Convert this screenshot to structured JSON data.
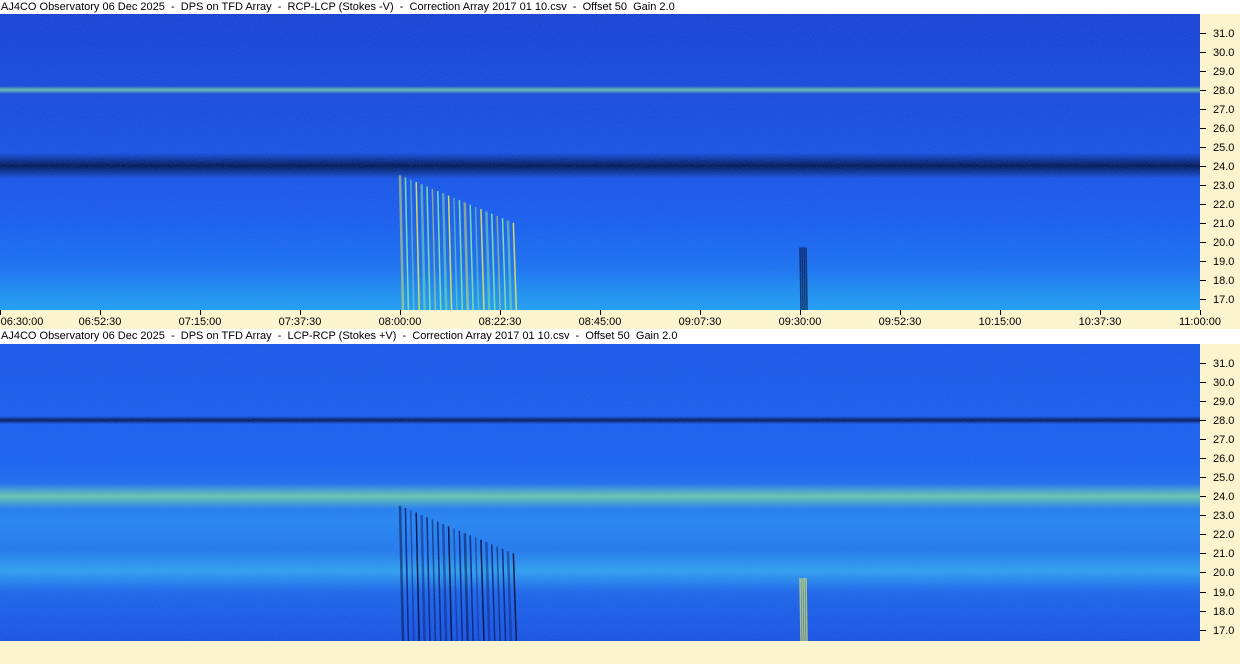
{
  "chart_data": [
    {
      "type": "heatmap",
      "title": "AJ4CO Observatory 06 Dec 2025  -  DPS on TFD Array  -  RCP-LCP (Stokes -V)  -  Correction Array 2017 01 10.csv  -  Offset 50  Gain 2.0",
      "x_tick_labels": [
        "06:30:00",
        "06:52:30",
        "07:15:00",
        "07:37:30",
        "08:00:00",
        "08:22:30",
        "08:45:00",
        "09:07:30",
        "09:30:00",
        "09:52:30",
        "10:15:00",
        "10:37:30",
        "11:00:00"
      ],
      "x_range": [
        "06:30:00",
        "11:00:00"
      ],
      "y_tick_labels": [
        "31.0",
        "30.0",
        "29.0",
        "28.0",
        "27.0",
        "26.0",
        "25.0",
        "24.0",
        "23.0",
        "22.0",
        "21.0",
        "20.0",
        "19.0",
        "18.0",
        "17.0"
      ],
      "y_range_mhz": [
        16.4,
        32.0
      ],
      "colors": {
        "low": "#00032a",
        "mid": "#1a5cf0",
        "high": "#8ff090",
        "peak": "#f5f040"
      },
      "features": [
        {
          "kind": "band",
          "freq_mhz": 24.0,
          "polarity": "dark"
        },
        {
          "kind": "band",
          "freq_mhz": 28.0,
          "polarity": "bright"
        },
        {
          "kind": "burst_train",
          "start": "08:00:00",
          "end": "08:25:30",
          "freq_top_mhz": 23.5,
          "freq_bottom_mhz": 16.4,
          "polarity": "bright"
        },
        {
          "kind": "spike",
          "time": "09:30:00",
          "freq_mhz": 18.5,
          "polarity": "dark"
        }
      ]
    },
    {
      "type": "heatmap",
      "title": "AJ4CO Observatory 06 Dec 2025  -  DPS on TFD Array  -  LCP-RCP (Stokes +V)  -  Correction Array 2017 01 10.csv  -  Offset 50  Gain 2.0",
      "x_tick_labels": [],
      "y_tick_labels": [
        "31.0",
        "30.0",
        "29.0",
        "28.0",
        "27.0",
        "26.0",
        "25.0",
        "24.0",
        "23.0",
        "22.0",
        "21.0",
        "20.0",
        "19.0",
        "18.0",
        "17.0"
      ],
      "y_range_mhz": [
        16.4,
        32.0
      ],
      "colors": {
        "low": "#00032a",
        "mid": "#1a5cf0",
        "high": "#8ff090",
        "peak": "#f5f040"
      },
      "features": [
        {
          "kind": "band",
          "freq_mhz": 24.0,
          "polarity": "bright"
        },
        {
          "kind": "band",
          "freq_mhz": 28.0,
          "polarity": "dark"
        },
        {
          "kind": "burst_train",
          "start": "08:00:00",
          "end": "08:25:30",
          "freq_top_mhz": 23.5,
          "freq_bottom_mhz": 16.4,
          "polarity": "dark"
        },
        {
          "kind": "spike",
          "time": "09:30:00",
          "freq_mhz": 18.5,
          "polarity": "bright"
        }
      ]
    }
  ]
}
